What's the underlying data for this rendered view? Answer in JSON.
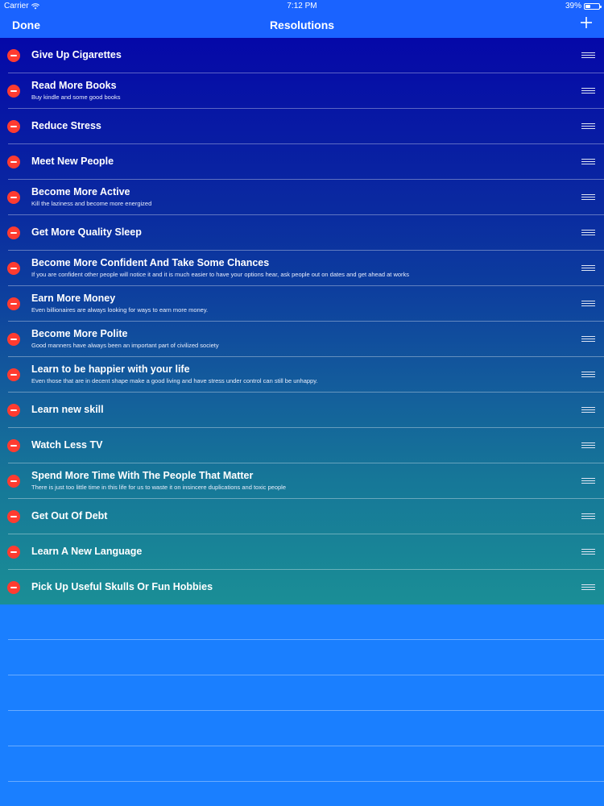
{
  "status_bar": {
    "carrier": "Carrier",
    "time": "7:12 PM",
    "battery": "39%",
    "battery_level": 0.39
  },
  "nav": {
    "left_button": "Done",
    "title": "Resolutions",
    "right_icon": "plus-icon"
  },
  "icons": {
    "delete": "minus-circle-icon",
    "reorder": "reorder-grip-icon"
  },
  "colors": {
    "nav_bar": "#1a63ff",
    "list_top": "#0508a8",
    "list_bottom": "#1a8e96",
    "delete_button": "#ff3b30",
    "empty_area": "#1a7fff"
  },
  "resolutions": [
    {
      "title": "Give Up Cigarettes",
      "subtitle": ""
    },
    {
      "title": "Read More Books",
      "subtitle": "Buy kindle and some good books"
    },
    {
      "title": "Reduce Stress",
      "subtitle": ""
    },
    {
      "title": "Meet New People",
      "subtitle": ""
    },
    {
      "title": "Become More Active",
      "subtitle": "Kill the laziness and become more energized"
    },
    {
      "title": "Get More Quality Sleep",
      "subtitle": ""
    },
    {
      "title": "Become More Confident And Take Some Chances",
      "subtitle": "If you are confident other people will notice it and it is much easier to have your options hear, ask people out on dates and get ahead at works"
    },
    {
      "title": "Earn More Money",
      "subtitle": "Even billionaires are always looking for ways to earn more money."
    },
    {
      "title": "Become More Polite",
      "subtitle": "Good manners have always been an important part of civilized society"
    },
    {
      "title": "Learn to be happier with your life",
      "subtitle": "Even those that are in decent shape make a good living and have stress under control can still be unhappy."
    },
    {
      "title": "Learn new skill",
      "subtitle": ""
    },
    {
      "title": "Watch Less TV",
      "subtitle": ""
    },
    {
      "title": "Spend More Time With The People That Matter",
      "subtitle": "There is just too little time in this life for us to waste it on insincere duplications and toxic people"
    },
    {
      "title": "Get Out Of Debt",
      "subtitle": ""
    },
    {
      "title": "Learn A New Language",
      "subtitle": ""
    },
    {
      "title": "Pick Up Useful Skulls Or Fun Hobbies",
      "subtitle": ""
    }
  ]
}
